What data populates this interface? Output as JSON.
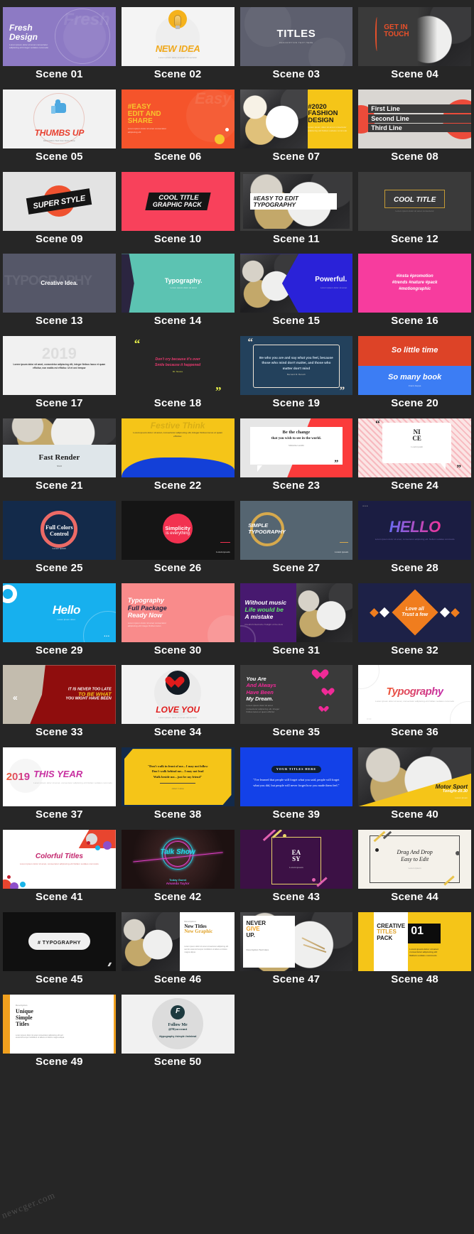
{
  "page": {
    "watermark": "newcger.com",
    "background": "#262626",
    "caption_color": "#ffffff",
    "columns": 4,
    "total_scenes": 50
  },
  "scenes": [
    {
      "id": 1,
      "caption": "Scene 01",
      "bg": "#8d7ac4",
      "title": "Fresh\nDesign",
      "body": "Lorem ipsum dolor sit amet consectetur adipiscing elit Integer sodales commodo",
      "ghost": "Fresh",
      "style": "purple-left",
      "text_color": "#ffffff"
    },
    {
      "id": 2,
      "caption": "Scene 02",
      "bg": "#f4f4f4",
      "title": "NEW IDEA",
      "body": "Lorem ipsum dolor sit amet consectetur",
      "style": "lightbulb",
      "accent": "#f5b21c",
      "text_color": "#f0a81a"
    },
    {
      "id": 3,
      "caption": "Scene 03",
      "bg": "#5d5f6e",
      "title": "TITLES",
      "body": "DESCRIPTION TEXT HERE",
      "style": "grey-titles",
      "text_color": "#ffffff"
    },
    {
      "id": 4,
      "caption": "Scene 04",
      "bg": "#3a3a3a",
      "title": "GET IN\nTOUCH",
      "style": "drum-dark",
      "accent": "#e8502a",
      "text_color": "#e8502a"
    },
    {
      "id": 5,
      "caption": "Scene 05",
      "bg": "#f2f2f2",
      "title": "THUMBS UP",
      "body": "Description Text Can Goes Here",
      "style": "thumbsup",
      "accent": "#4da8e0",
      "text_color": "#e8402f"
    },
    {
      "id": 6,
      "caption": "Scene 06",
      "bg": "#f5542b",
      "title": "#EASY\nEDIT AND\nSHARE",
      "body": "Lorem ipsum dolor sit amet consectetur adipiscing elit",
      "ghost": "Easy",
      "style": "orange-left",
      "accent": "#f7c52d",
      "text_color": "#f7c52d"
    },
    {
      "id": 7,
      "caption": "Scene 07",
      "bg": "#f5c518",
      "title": "#2020\nFASHION\nDESIGN",
      "body": "Lorem ipsum dolor sit amet consectetur adipiscing elit Nullam sodales commodo",
      "style": "yellow-drum",
      "text_color": "#1b1b1b"
    },
    {
      "id": 8,
      "caption": "Scene 08",
      "bg": "#d9d6d2",
      "lines": [
        "First Line",
        "Second Line",
        "Third Line"
      ],
      "style": "three-lines",
      "accent": "#ec4b3a",
      "text_color": "#ffffff"
    },
    {
      "id": 9,
      "caption": "Scene 09",
      "bg": "#e3e3e3",
      "title": "SUPER STYLE",
      "style": "super-style",
      "accent": "#ef5230",
      "text_color": "#ffffff"
    },
    {
      "id": 10,
      "caption": "Scene 10",
      "bg": "#f8415b",
      "title": "COOL TITLE",
      "subtitle": "GRAPHIC PACK",
      "style": "cool-title-pack",
      "text_color": "#ffffff"
    },
    {
      "id": 11,
      "caption": "Scene 11",
      "bg": "#3b3b3b",
      "title": "#EASY TO EDIT\nTYPOGRAPHY",
      "style": "drum-white-band",
      "text_color": "#1b1b1b"
    },
    {
      "id": 12,
      "caption": "Scene 12",
      "bg": "#3a3a3a",
      "title": "COOL TITLE",
      "body": "Lorem ipsum dolor sit amet consectetur",
      "style": "gold-box",
      "accent": "#c59b35",
      "text_color": "#ffffff"
    },
    {
      "id": 13,
      "caption": "Scene 13",
      "bg": "#555768",
      "title": "Creative Idea.",
      "ghost": "TYPOGRAPHY",
      "style": "creative-idea",
      "text_color": "#ffffff"
    },
    {
      "id": 14,
      "caption": "Scene 14",
      "bg": "#5cc3b2",
      "title": "Typography.",
      "body": "Lorem ipsum dolor sit amet",
      "style": "teal-arrow",
      "accent": "#2b2540",
      "text_color": "#ffffff"
    },
    {
      "id": 15,
      "caption": "Scene 15",
      "bg": "#2a22d8",
      "title": "Powerful.",
      "body": "Lorem ipsum dolor sit amet",
      "style": "blue-arrow-drum",
      "text_color": "#ffffff"
    },
    {
      "id": 16,
      "caption": "Scene 16",
      "bg": "#f73c9e",
      "title": "#insta #promotion\n#trends #nature #pack\n#motiongraphic",
      "style": "pink-hashtags",
      "text_color": "#ffffff"
    },
    {
      "id": 17,
      "caption": "Scene 17",
      "bg": "#f1f1f1",
      "ghost": "2019",
      "body": "Lorem ipsum dolor sit amet, consectetur adipiscing elit, integer finibus lacus et quam efficitur, non mattis est efficitur. Ut et orci tempor",
      "style": "white-lorem",
      "text_color": "#1b1b1b"
    },
    {
      "id": 18,
      "caption": "Scene 18",
      "bg": "#262626",
      "title": "Don't cry because it's over\nSmile because it happened",
      "author": "Dr. Seuss",
      "style": "quote-yellow",
      "accent": "#e9f24a",
      "text_color": "#e8396f"
    },
    {
      "id": 19,
      "caption": "Scene 19",
      "bg": "#23415c",
      "title": "Be who you are and say what you feel, because those who mind don't matter, and those who matter don't mind",
      "author": "Bernard M. Baruch",
      "style": "quote-frame",
      "accent": "#f0e6d8",
      "text_color": "#cfe0ee"
    },
    {
      "id": 20,
      "caption": "Scene 20",
      "bg": "#dd4327",
      "title": "So little time",
      "subtitle": "So many book",
      "author": "Frank Zappa",
      "style": "split-two-color",
      "accent": "#3c7df4",
      "text_color": "#ffffff"
    },
    {
      "id": 21,
      "caption": "Scene 21",
      "bg": "#dfe6ea",
      "title": "Fast Render",
      "subtitle": "V1.0",
      "style": "fast-render",
      "text_color": "#1b1b1b"
    },
    {
      "id": 22,
      "caption": "Scene 22",
      "bg": "#f5c518",
      "ghost": "Festive Think",
      "body": "Lorem ipsum dolor sit amet, consectetur adipiscing elit, Integer finibus lacus et quam efficitur.",
      "style": "yellow-blue-wave",
      "accent": "#1340d8",
      "text_color": "#1b1b1b"
    },
    {
      "id": 23,
      "caption": "Scene 23",
      "bg": "#e6e6e6",
      "title": "Be the change",
      "subtitle": "that you wish to see in the world.",
      "author": "Mahatma Gandhi",
      "style": "speech-red",
      "accent": "#fb3b3b",
      "text_color": "#1b1b1b"
    },
    {
      "id": 24,
      "caption": "Scene 24",
      "bg": "#fbe4e4",
      "title": "NI\nCE",
      "body": "Lorem ipsum",
      "style": "speech-pink",
      "text_color": "#1b1b1b"
    },
    {
      "id": 25,
      "caption": "Scene 25",
      "bg": "#132a4a",
      "title": "Full Colors\nControl",
      "body": "Lorem Ipsum",
      "style": "ring-red",
      "accent": "#ec6a66",
      "text_color": "#ffffff"
    },
    {
      "id": 26,
      "caption": "Scene 26",
      "bg": "#151515",
      "title": "Simplicity",
      "subtitle": "is everything",
      "body": "Lorem ipsum",
      "style": "circle-red",
      "accent": "#f23150",
      "text_color": "#ffffff"
    },
    {
      "id": 27,
      "caption": "Scene 27",
      "bg": "#556571",
      "title": "SIMPLE\nTYPOGRAPHY",
      "body": "Lorem ipsum",
      "style": "ring-gold",
      "accent": "#d6a94d",
      "text_color": "#ffffff"
    },
    {
      "id": 28,
      "caption": "Scene 28",
      "bg": "#1b1d42",
      "title": "HELLO",
      "body": "Lorem ipsum dolor sit amet, consectetur adipiscing elit. Nullam sodales commodo",
      "style": "hello-gradient",
      "accent": "#f0359b",
      "text_color": "#6a6af0"
    },
    {
      "id": 29,
      "caption": "Scene 29",
      "bg": "#17b0ee",
      "title": "Hello",
      "body": "Lorem ipsum dolor.",
      "style": "cyan-hello",
      "text_color": "#ffffff"
    },
    {
      "id": 30,
      "caption": "Scene 30",
      "bg": "#f98b8b",
      "title": "Typography\nFull Package\nReady Now",
      "body": "Lorem ipsum dolor sit amet consectetur adipiscing elit Integer finibus lacus",
      "style": "salmon-left",
      "accent": "#1e2440",
      "text_color": "#ffffff"
    },
    {
      "id": 31,
      "caption": "Scene 31",
      "bg": "#47196f",
      "title": "Without music\nLife would be\nA mistake",
      "body": "Friedrich Nietzsche Twilight of the Idols",
      "style": "purple-drum",
      "accent": "#5ce86a",
      "text_color": "#ffffff"
    },
    {
      "id": 32,
      "caption": "Scene 32",
      "bg": "#1d2147",
      "title": "Love all\nTrust a few",
      "style": "diamonds",
      "accent": "#f07d1e",
      "text_color": "#ffffff"
    },
    {
      "id": 33,
      "caption": "Scene 33",
      "bg": "#c3bcae",
      "title": "IT IS NEVER TOO LATE",
      "subtitle": "TO BE WHAT",
      "extra": "YOU MIGHT HAVE BEEN",
      "style": "arrow-red",
      "accent": "#8f0d0d",
      "text_color": "#ffffff"
    },
    {
      "id": 34,
      "caption": "Scene 34",
      "bg": "#f3f3f3",
      "title": "LOVE YOU",
      "body": "Lorem ipsum dolor sit amet consectetur",
      "style": "heart",
      "accent": "#e01b1b",
      "text_color": "#e01b1b"
    },
    {
      "id": 35,
      "caption": "Scene 35",
      "bg": "#3a3a3a",
      "title": "You Are\nAnd Always\nHave Been\nMy Dream.",
      "body": "Lorem ipsum dolor sit amet consectetur adipiscing elit, Integer finibus lacus et quam efficitur",
      "style": "hearts-pink",
      "accent": "#ef2a97",
      "text_color": "#ffffff"
    },
    {
      "id": 36,
      "caption": "Scene 36",
      "bg": "#ffffff",
      "title": "Typography",
      "body": "Lorem ipsum dolor sit amet, consectetur adipiscing elit Nullam sodales commodo",
      "style": "gradient-type",
      "text_color": "#e0357f"
    },
    {
      "id": 37,
      "caption": "Scene 37",
      "bg": "#ffffff",
      "title": "2019",
      "subtitle": "THIS YEAR",
      "body": "Lorem ipsum dolor sit amet, consectetur adipiscing elit Nullam sodales commodo",
      "style": "year-2019",
      "text_color": "#c72fa0"
    },
    {
      "id": 38,
      "caption": "Scene 38",
      "bg": "#f5c518",
      "title": "\"Don't walk in front of me... I may not follow\nDon't walk behind me... I may not lead\nWalk beside me... just be my friend\"",
      "author": "Albert Camus",
      "style": "yellow-quote",
      "accent": "#132a4a",
      "text_color": "#1b1b1b"
    },
    {
      "id": 39,
      "caption": "Scene 39",
      "bg": "#1341e8",
      "badge": "YOUR TITLES HERE",
      "title": "\"I've learned that people will forget what you said, people will forget what you did, but people will never forget how you made them feel.\"",
      "style": "blue-quote",
      "text_color": "#ffffff"
    },
    {
      "id": 40,
      "caption": "Scene 40",
      "bg": "#3a3a3a",
      "title": "Motor Sport",
      "subtitle": "Tonight 20.30",
      "body": "Lorem ipsum",
      "style": "motor-sport",
      "accent": "#f5c518",
      "text_color": "#1b1b1b"
    },
    {
      "id": 41,
      "caption": "Scene 41",
      "bg": "#ffffff",
      "title": "Colorful Titles",
      "body": "Lorem ipsum dolor sit amet, consectetur adipiscing elit Nullam sodales commodo",
      "style": "colorful-bubbles",
      "text_color": "#c2246c"
    },
    {
      "id": 42,
      "caption": "Scene 42",
      "bg": "#2b1718",
      "title": "Talk Show",
      "subtitle": "Today Guest",
      "body": "Amanda Taylor",
      "style": "neon-talkshow",
      "accent": "#26d7e8",
      "text_color": "#26d7e8"
    },
    {
      "id": 43,
      "caption": "Scene 43",
      "bg": "#3c1145",
      "title": "EA\nSY",
      "body": "Lorem ipsum",
      "style": "easy-frame",
      "accent": "#e8d36a",
      "text_color": "#ffffff"
    },
    {
      "id": 44,
      "caption": "Scene 44",
      "bg": "#f4f1ea",
      "title": "Drag And Drop\nEasy to Edit",
      "body": "Lorem ipsum",
      "style": "drag-drop",
      "accent": "#e8c24a",
      "text_color": "#1b1b1b"
    },
    {
      "id": 45,
      "caption": "Scene 45",
      "bg": "#101010",
      "title": "# TYPOGRAPHY",
      "style": "pill-typography",
      "text_color": "#1b1b1b"
    },
    {
      "id": 46,
      "caption": "Scene 46",
      "bg": "#3a3a3a",
      "label": "Description",
      "title": "New Titles",
      "subtitle": "New Graphic",
      "body": "Lorem ipsum dolor sit amet consectetur adipiscing elit sed do eiusmod tempor incididunt ut labore et dolore magna aliqua",
      "style": "new-titles",
      "accent": "#e0a32a",
      "text_color": "#1b1b1b"
    },
    {
      "id": 47,
      "caption": "Scene 47",
      "bg": "#3a3a3a",
      "title": "NEVER",
      "subtitle": "GIVE",
      "extra": "UP.",
      "body": "Description Text Here",
      "style": "never-give-up",
      "accent": "#f0a01e",
      "text_color": "#1b1b1b"
    },
    {
      "id": 48,
      "caption": "Scene 48",
      "bg": "#f5c518",
      "title": "CREATIVE",
      "subtitle": "TITLES",
      "extra": "PACK",
      "number": "01",
      "body": "Lorem ipsum dolor sit amet consectetur adipiscing elit Nullam sodales commodo",
      "style": "creative-pack",
      "accent": "#e0a32a",
      "text_color": "#1b1b1b"
    },
    {
      "id": 49,
      "caption": "Scene 49",
      "bg": "#ffffff",
      "label": "Description",
      "title": "Unique\nSimple\nTitles",
      "body": "Lorem ipsum dolor sit amet consectetur adipiscing elit sed eiusmod tempor incididunt ut labore et dolore magna aliqua",
      "style": "unique-simple",
      "accent": "#f0a01e",
      "text_color": "#1b1b1b"
    },
    {
      "id": 50,
      "caption": "Scene 50",
      "bg": "#f1f1f1",
      "title": "Follow Me",
      "subtitle": "@Myaccount",
      "body": "#typography #simple #minimal",
      "logo": "F",
      "style": "follow-me",
      "accent": "#1d3a3f",
      "text_color": "#1d3a3f"
    }
  ]
}
